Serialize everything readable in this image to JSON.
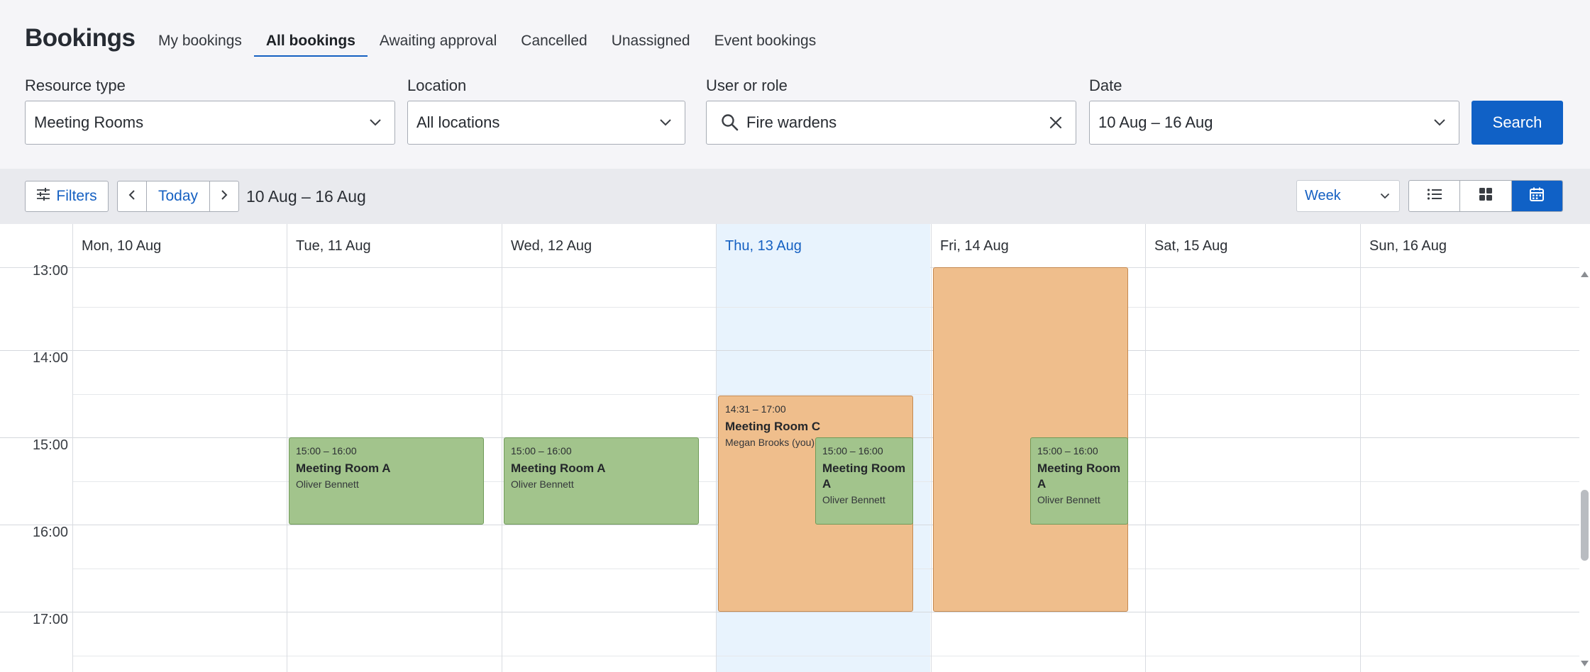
{
  "app": {
    "title": "Bookings"
  },
  "tabs": [
    {
      "label": "My bookings",
      "active": false
    },
    {
      "label": "All bookings",
      "active": true
    },
    {
      "label": "Awaiting approval",
      "active": false
    },
    {
      "label": "Cancelled",
      "active": false
    },
    {
      "label": "Unassigned",
      "active": false
    },
    {
      "label": "Event bookings",
      "active": false
    }
  ],
  "filters": {
    "resource_type": {
      "label": "Resource type",
      "value": "Meeting Rooms"
    },
    "location": {
      "label": "Location",
      "value": "All locations"
    },
    "user_or_role": {
      "label": "User or role",
      "value": "Fire wardens"
    },
    "date": {
      "label": "Date",
      "value": "10 Aug – 16 Aug"
    },
    "search_label": "Search"
  },
  "toolbar": {
    "filters_label": "Filters",
    "today_label": "Today",
    "date_range": "10 Aug – 16 Aug",
    "view": "Week",
    "active_view": "calendar"
  },
  "calendar": {
    "days": [
      {
        "label": "Mon, 10 Aug",
        "today": false
      },
      {
        "label": "Tue, 11 Aug",
        "today": false
      },
      {
        "label": "Wed, 12 Aug",
        "today": false
      },
      {
        "label": "Thu, 13 Aug",
        "today": true
      },
      {
        "label": "Fri, 14 Aug",
        "today": false
      },
      {
        "label": "Sat, 15 Aug",
        "today": false
      },
      {
        "label": "Sun, 16 Aug",
        "today": false
      }
    ],
    "hours": [
      "13:00",
      "14:00",
      "15:00",
      "16:00",
      "17:00"
    ],
    "events": [
      {
        "day": 1,
        "time": "15:00 – 16:00",
        "title": "Meeting Room A",
        "person": "Oliver Bennett",
        "color": "green"
      },
      {
        "day": 2,
        "time": "15:00 – 16:00",
        "title": "Meeting Room A",
        "person": "Oliver Bennett",
        "color": "green"
      },
      {
        "day": 3,
        "time": "14:31 – 17:00",
        "title": "Meeting Room C",
        "person": "Megan Brooks (you)",
        "color": "orange"
      },
      {
        "day": 3,
        "time": "15:00 – 16:00",
        "title": "Meeting Room A",
        "person": "Oliver Bennett",
        "color": "green"
      },
      {
        "day": 4,
        "time": "",
        "title": "",
        "person": "",
        "color": "orange"
      },
      {
        "day": 4,
        "time": "15:00 – 16:00",
        "title": "Meeting Room A",
        "person": "Oliver Bennett",
        "color": "green"
      }
    ]
  },
  "colors": {
    "accent": "#1061c6",
    "today_bg": "#e8f3fd",
    "event_green": "#a2c48c",
    "event_orange": "#efbe8c"
  },
  "icons": {
    "resource_chevron": "chevron-down-icon",
    "search": "search-icon",
    "clear": "close-icon",
    "filters": "sliders-icon",
    "views": [
      "list-icon",
      "grid-icon",
      "calendar-icon"
    ]
  }
}
